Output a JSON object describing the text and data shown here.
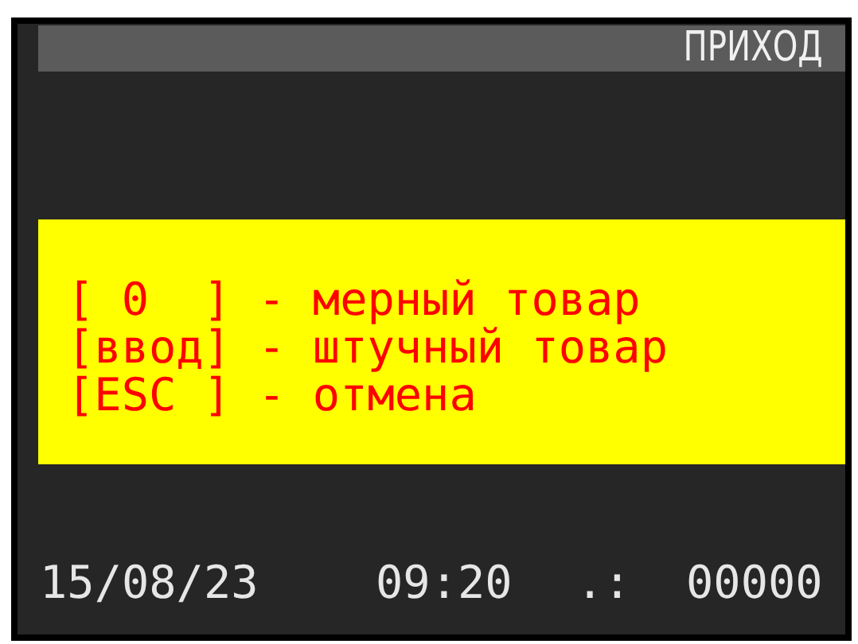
{
  "header": {
    "title": "ПРИХОД"
  },
  "prompt": {
    "lines": [
      "[ 0  ] - мерный товар",
      "[ввод] - штучный товар",
      "[ESC ] - отмена"
    ]
  },
  "status_bar": {
    "date": "15/08/23",
    "time": "09:20",
    "separator": ".:",
    "counter": "00000"
  }
}
